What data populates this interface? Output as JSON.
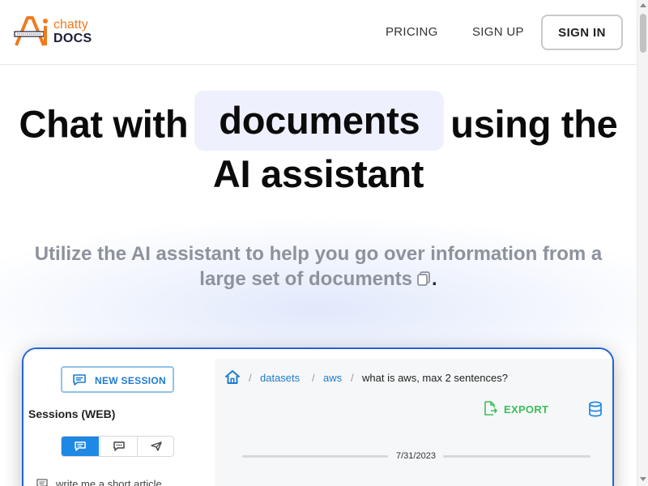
{
  "header": {
    "logo_top": "chatty",
    "logo_bottom": "DOCS",
    "nav": [
      "PRICING",
      "SIGN UP"
    ],
    "signin_label": "SIGN IN"
  },
  "hero": {
    "title_part1": "Chat with",
    "title_highlight": "documents",
    "title_part2": "using the",
    "title_line2": "AI assistant",
    "subtitle": "Utilize the AI assistant to help you go over information from a large set of documents",
    "subtitle_end": "."
  },
  "preview": {
    "new_session_label": "NEW SESSION",
    "sessions_title": "Sessions (WEB)",
    "session_item": "write me a short article...",
    "breadcrumb": {
      "items": [
        "datasets",
        "aws"
      ],
      "current": "what is aws, max 2 sentences?"
    },
    "export_label": "EXPORT",
    "date": "7/31/2023"
  },
  "colors": {
    "accent_blue": "#1e88e5",
    "border_blue": "#2563d6",
    "export_green": "#3bbf5a",
    "logo_orange": "#f07a1d"
  }
}
